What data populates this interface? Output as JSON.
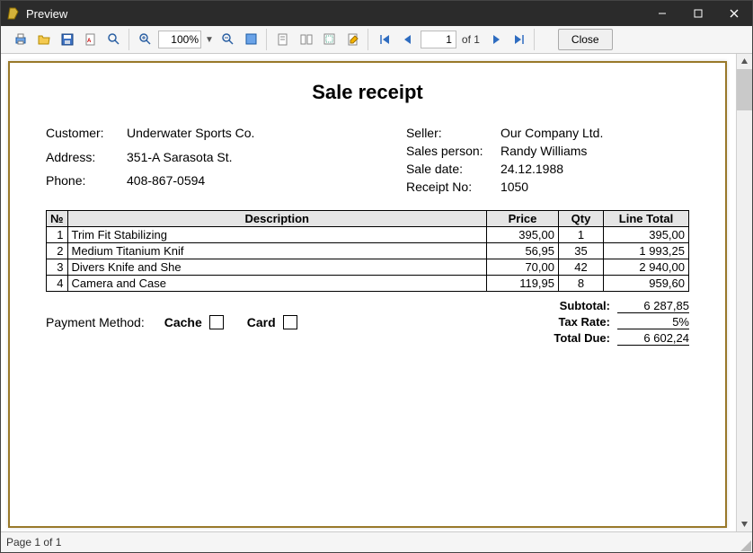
{
  "window": {
    "title": "Preview"
  },
  "toolbar": {
    "zoom": "100%",
    "page_current": "1",
    "of_label": "of 1",
    "close_label": "Close"
  },
  "report": {
    "title": "Sale receipt",
    "customer_label": "Customer:",
    "customer": "Underwater Sports Co.",
    "address_label": "Address:",
    "address": "351-A Sarasota St.",
    "phone_label": "Phone:",
    "phone": "408-867-0594",
    "seller_label": "Seller:",
    "seller": "Our Company Ltd.",
    "salesperson_label": "Sales person:",
    "salesperson": "Randy Williams",
    "saledate_label": "Sale date:",
    "saledate": "24.12.1988",
    "receiptno_label": "Receipt No:",
    "receiptno": "1050",
    "columns": {
      "idx": "№",
      "desc": "Description",
      "price": "Price",
      "qty": "Qty",
      "total": "Line Total"
    },
    "items": [
      {
        "idx": "1",
        "desc": "Trim Fit Stabilizing",
        "price": "395,00",
        "qty": "1",
        "total": "395,00"
      },
      {
        "idx": "2",
        "desc": "Medium Titanium Knif",
        "price": "56,95",
        "qty": "35",
        "total": "1 993,25"
      },
      {
        "idx": "3",
        "desc": "Divers Knife and She",
        "price": "70,00",
        "qty": "42",
        "total": "2 940,00"
      },
      {
        "idx": "4",
        "desc": "Camera and Case",
        "price": "119,95",
        "qty": "8",
        "total": "959,60"
      }
    ],
    "pay_label": "Payment Method:",
    "pay_opt1": "Cache",
    "pay_opt2": "Card",
    "subtotal_label": "Subtotal:",
    "subtotal": "6 287,85",
    "taxrate_label": "Tax Rate:",
    "taxrate": "5%",
    "totaldue_label": "Total Due:",
    "totaldue": "6 602,24"
  },
  "statusbar": {
    "text": "Page 1 of 1"
  }
}
